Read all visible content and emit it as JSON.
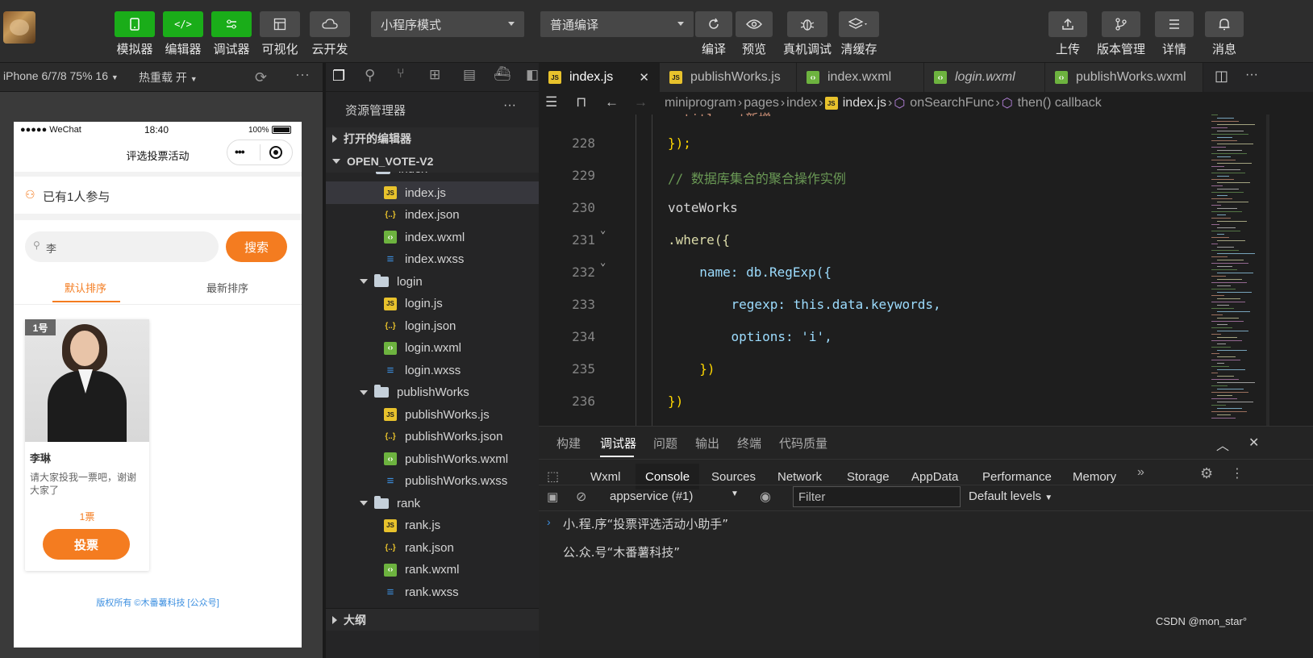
{
  "toolbar": {
    "buttons": [
      {
        "label": "模拟器"
      },
      {
        "label": "编辑器"
      },
      {
        "label": "调试器"
      },
      {
        "label": "可视化"
      },
      {
        "label": "云开发"
      }
    ],
    "mode_select": "小程序模式",
    "compile_select": "普通编译",
    "actions": [
      {
        "label": "编译"
      },
      {
        "label": "预览"
      },
      {
        "label": "真机调试"
      },
      {
        "label": "清缓存"
      }
    ],
    "right": [
      {
        "label": "上传"
      },
      {
        "label": "版本管理"
      },
      {
        "label": "详情"
      },
      {
        "label": "消息"
      }
    ]
  },
  "simulator": {
    "device": "iPhone 6/7/8 75% 16",
    "hotreload": "热重载 开",
    "status_carrier": "●●●●● WeChat",
    "status_time": "18:40",
    "status_battery": "100%",
    "page_title": "评选投票活动",
    "participants": "已有1人参与",
    "search_value": "李",
    "search_button": "搜索",
    "sort_tabs": [
      "默认排序",
      "最新排序"
    ],
    "card": {
      "badge": "1号",
      "name": "李琳",
      "desc": "请大家投我一票吧，谢谢大家了",
      "votes": "1票",
      "vote_button": "投票"
    },
    "footer": "版权所有 ©木番薯科技 [公众号]"
  },
  "explorer": {
    "title": "资源管理器",
    "open_editors": "打开的编辑器",
    "project": "OPEN_VOTE-V2",
    "partial_folder": "index",
    "items": [
      {
        "type": "js",
        "name": "index.js",
        "depth": 2,
        "selected": true
      },
      {
        "type": "json",
        "name": "index.json",
        "depth": 2
      },
      {
        "type": "wxml",
        "name": "index.wxml",
        "depth": 2
      },
      {
        "type": "wxss",
        "name": "index.wxss",
        "depth": 2
      },
      {
        "type": "folder",
        "name": "login",
        "depth": 1
      },
      {
        "type": "js",
        "name": "login.js",
        "depth": 2
      },
      {
        "type": "json",
        "name": "login.json",
        "depth": 2
      },
      {
        "type": "wxml",
        "name": "login.wxml",
        "depth": 2
      },
      {
        "type": "wxss",
        "name": "login.wxss",
        "depth": 2
      },
      {
        "type": "folder",
        "name": "publishWorks",
        "depth": 1
      },
      {
        "type": "js",
        "name": "publishWorks.js",
        "depth": 2
      },
      {
        "type": "json",
        "name": "publishWorks.json",
        "depth": 2
      },
      {
        "type": "wxml",
        "name": "publishWorks.wxml",
        "depth": 2
      },
      {
        "type": "wxss",
        "name": "publishWorks.wxss",
        "depth": 2
      },
      {
        "type": "folder",
        "name": "rank",
        "depth": 1
      },
      {
        "type": "js",
        "name": "rank.js",
        "depth": 2
      },
      {
        "type": "json",
        "name": "rank.json",
        "depth": 2
      },
      {
        "type": "wxml",
        "name": "rank.wxml",
        "depth": 2
      },
      {
        "type": "wxss",
        "name": "rank.wxss",
        "depth": 2
      }
    ],
    "outline": "大纲"
  },
  "editor": {
    "tabs": [
      {
        "name": "index.js",
        "type": "js",
        "active": true
      },
      {
        "name": "publishWorks.js",
        "type": "js"
      },
      {
        "name": "index.wxml",
        "type": "wxml"
      },
      {
        "name": "login.wxml",
        "type": "wxml"
      },
      {
        "name": "publishWorks.wxml",
        "type": "wxml"
      }
    ],
    "breadcrumb": [
      "miniprogram",
      "pages",
      "index",
      "index.js",
      "onSearchFunc",
      "then() callback"
    ],
    "lines": [
      {
        "n": "228",
        "text": "});"
      },
      {
        "n": "229",
        "text": "// 数据库集合的聚合操作实例"
      },
      {
        "n": "230",
        "text": "voteWorks"
      },
      {
        "n": "231",
        "text": ".where({"
      },
      {
        "n": "232",
        "text": "  name: db.RegExp({"
      },
      {
        "n": "233",
        "text": "    regexp: this.data.keywords,"
      },
      {
        "n": "234",
        "text": "    options: 'i',"
      },
      {
        "n": "235",
        "text": "  })"
      },
      {
        "n": "236",
        "text": "})"
      }
    ]
  },
  "panel": {
    "tabs": [
      "构建",
      "调试器",
      "问题",
      "输出",
      "终端",
      "代码质量"
    ],
    "devtools_tabs": [
      "Wxml",
      "Console",
      "Sources",
      "Network",
      "Storage",
      "AppData",
      "Performance",
      "Memory"
    ],
    "context": "appservice (#1)",
    "filter_placeholder": "Filter",
    "levels": "Default levels",
    "messages": [
      "小.程.序“投票评选活动小助手”",
      "公.众.号“木番薯科技”"
    ]
  },
  "watermark": "CSDN @mon_star°",
  "colors": {
    "accent_green": "#1aad19",
    "orange": "#f47c20",
    "js_yellow": "#e8c22c"
  }
}
